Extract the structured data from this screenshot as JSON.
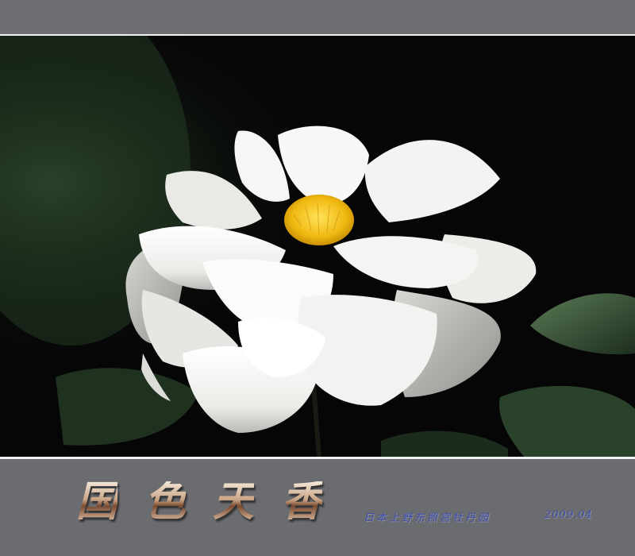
{
  "title_chars": [
    "国",
    "色",
    "天",
    "香"
  ],
  "caption": "日本上野东照宫牡丹园",
  "date": "2009.04",
  "colors": {
    "frame": "#6e6f73",
    "rule": "#f2f2f2",
    "caption": "#3c4fb0",
    "petal": "#f4f4f2",
    "stamen": "#f3c418",
    "leaf": "#2f4a30"
  },
  "subject": {
    "description_icon": "white-peony-flower"
  }
}
